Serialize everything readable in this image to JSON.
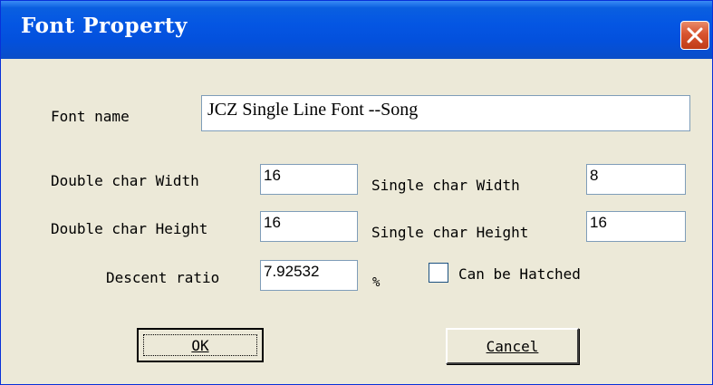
{
  "window": {
    "title": "Font Property"
  },
  "font_name": {
    "label": "Font name",
    "value": "JCZ Single Line Font --Song"
  },
  "double_char_width": {
    "label": "Double char Width",
    "value": "16"
  },
  "single_char_width": {
    "label": "Single char Width",
    "value": "8"
  },
  "double_char_height": {
    "label": "Double char Height",
    "value": "16"
  },
  "single_char_height": {
    "label": "Single char Height",
    "value": "16"
  },
  "descent_ratio": {
    "label": "Descent ratio",
    "value": "7.92532",
    "unit": "%"
  },
  "can_be_hatched": {
    "label": "Can be Hatched",
    "checked": false
  },
  "buttons": {
    "ok_label": "OK",
    "cancel_label": "Cancel"
  },
  "colors": {
    "titlebar": "#0456e3",
    "dialog_bg": "#ece9d8",
    "close_button": "#d8542f",
    "field_border": "#7f9db9"
  }
}
